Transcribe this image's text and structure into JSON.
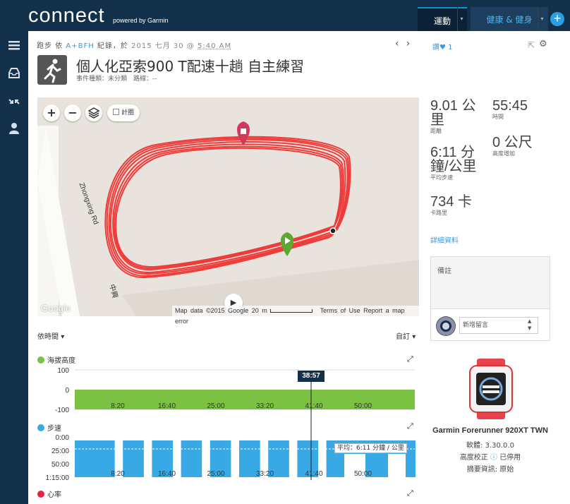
{
  "header": {
    "logo": "connect",
    "logo_sub": "powered by Garmin",
    "tab_active": "運動",
    "tab_health": "健康 & 健身",
    "add_button": "+"
  },
  "sidebar": {
    "icons": [
      "menu-icon",
      "inbox-icon",
      "shrink-icon",
      "user-icon"
    ]
  },
  "activity": {
    "sport": "跑步",
    "by": "依",
    "user": "A+BFH",
    "recorded": "紀錄，於",
    "date": "2015 七月 30",
    "at": "@",
    "time": "5:40 AM",
    "title": "個人化亞索900 T配速十趟 自主練習",
    "meta": "事件種類：未分類　路線：--",
    "likes_label": "讚",
    "likes_count": "1"
  },
  "map": {
    "zoom_in": "+",
    "zoom_out": "−",
    "layers_toggle": "計圈",
    "road_left": "Zhongxing Rd",
    "road_top": "Ro",
    "road_bottom": "中興",
    "attribution": "Map data ©2015 Google",
    "scale": "20 m",
    "terms": "Terms of Use",
    "report": "Report a map error",
    "google": "Google"
  },
  "stats": {
    "distance_value": "9.01 公里",
    "distance_label": "距離",
    "time_value": "55:45",
    "time_label": "時間",
    "pace_value": "6:11 分鐘/公里",
    "pace_label": "平均步速",
    "elev_value": "0 公尺",
    "elev_label": "高度增加",
    "calories_value": "734 卡",
    "calories_label": "卡路里",
    "details_link": "詳細資料"
  },
  "notes": {
    "label": "備註",
    "comment_placeholder": "新增留言"
  },
  "device": {
    "name": "Garmin Forerunner 920XT TWN",
    "software": "軟體: 3.30.0.0",
    "elev_correction_label": "高度校正",
    "elev_correction_value": "已停用",
    "summary": "摘要資訊: 原始"
  },
  "charts": {
    "by_time": "依時間",
    "custom": "自訂",
    "elevation_title": "海拔高度",
    "speed_title": "步速",
    "heart_title": "心率",
    "cursor_label": "38:57",
    "avg_label": "平均：6:11 分鐘 / 公里"
  },
  "colors": {
    "nav": "#13304b",
    "accent": "#3a9ad9",
    "elevation": "#7cc242",
    "speed": "#38a9e4",
    "route": "#f02a2a",
    "heart": "#e52442"
  },
  "chart_data": [
    {
      "type": "area",
      "title": "海拔高度",
      "x": [
        "8:20",
        "16:40",
        "25:00",
        "33:20",
        "41:40",
        "50:00"
      ],
      "yticks": [
        "100",
        "0",
        "-100"
      ],
      "ylim": [
        -100,
        100
      ],
      "values": [
        0,
        0,
        0,
        0,
        0,
        0
      ]
    },
    {
      "type": "area",
      "title": "步速",
      "x": [
        "8:20",
        "16:40",
        "25:00",
        "33:20",
        "41:40",
        "50:00"
      ],
      "yticks": [
        "0:00",
        "25:00",
        "50:00",
        "1:15:00"
      ],
      "ylim": [
        "0:00",
        "1:15:00"
      ],
      "reps": 10,
      "avg_pace": "6:11"
    }
  ]
}
